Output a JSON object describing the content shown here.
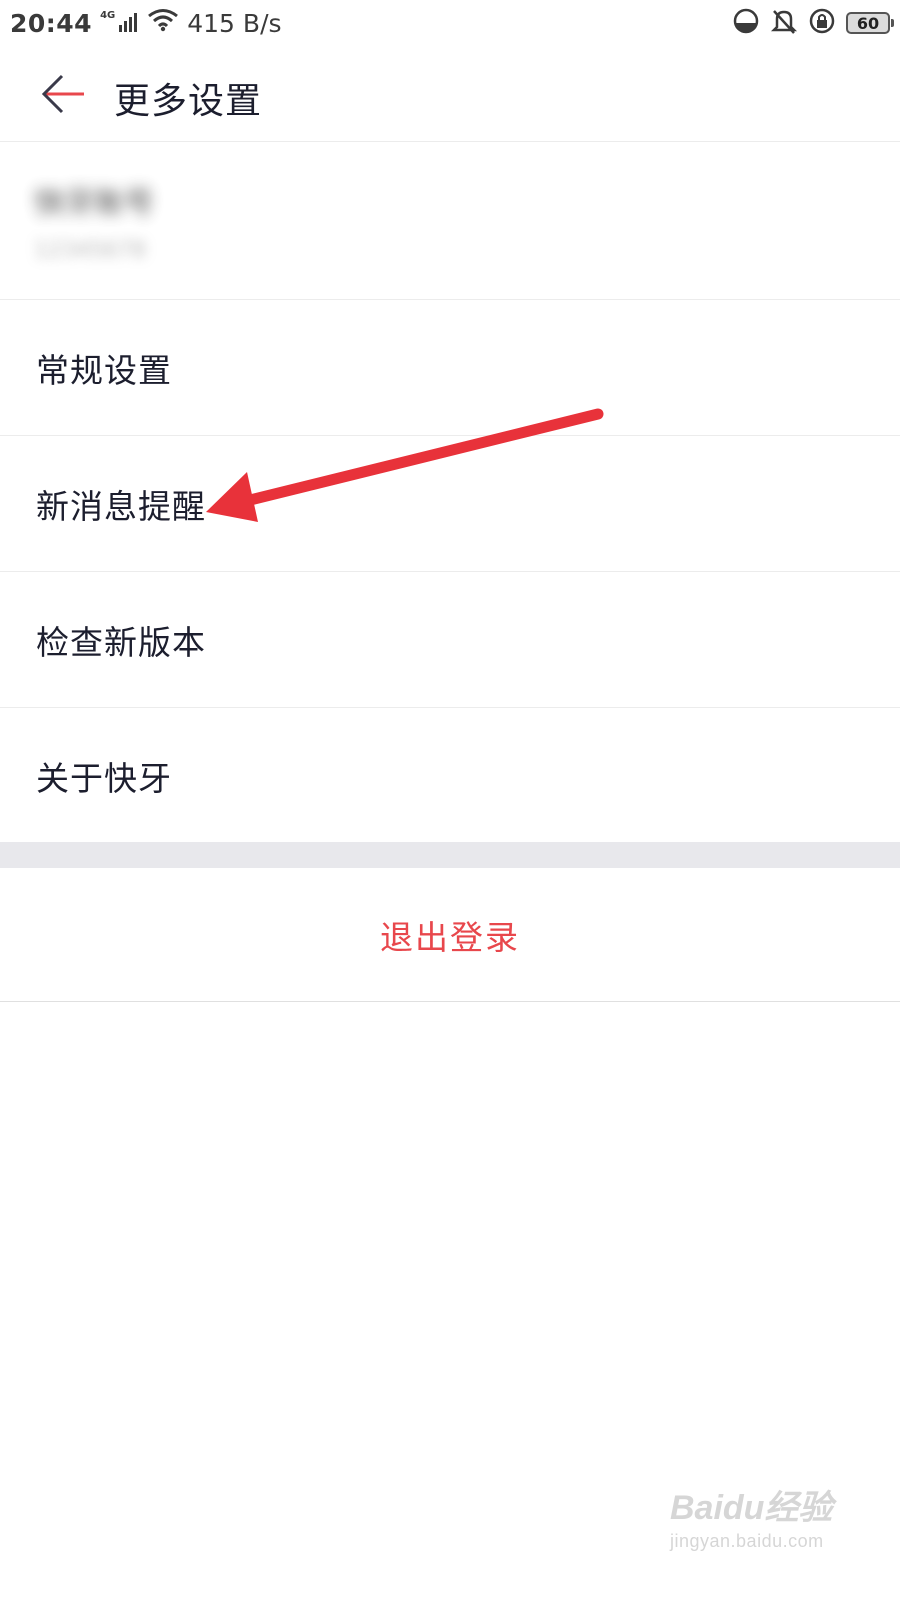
{
  "status_bar": {
    "time": "20:44",
    "network_type": "4G",
    "speed": "415 B/s",
    "battery": "60"
  },
  "header": {
    "title": "更多设置",
    "back_icon": "arrow-left-icon"
  },
  "account": {
    "name": "快牙账号",
    "id": "12345678"
  },
  "menu": {
    "items": [
      {
        "label": "常规设置"
      },
      {
        "label": "新消息提醒"
      },
      {
        "label": "检查新版本"
      },
      {
        "label": "关于快牙"
      }
    ]
  },
  "logout": {
    "label": "退出登录"
  },
  "watermark": {
    "logo": "Baidu经验",
    "url": "jingyan.baidu.com"
  },
  "colors": {
    "accent": "#e8474c",
    "annotation_arrow": "#e8323a",
    "text": "#1c1e2e"
  }
}
